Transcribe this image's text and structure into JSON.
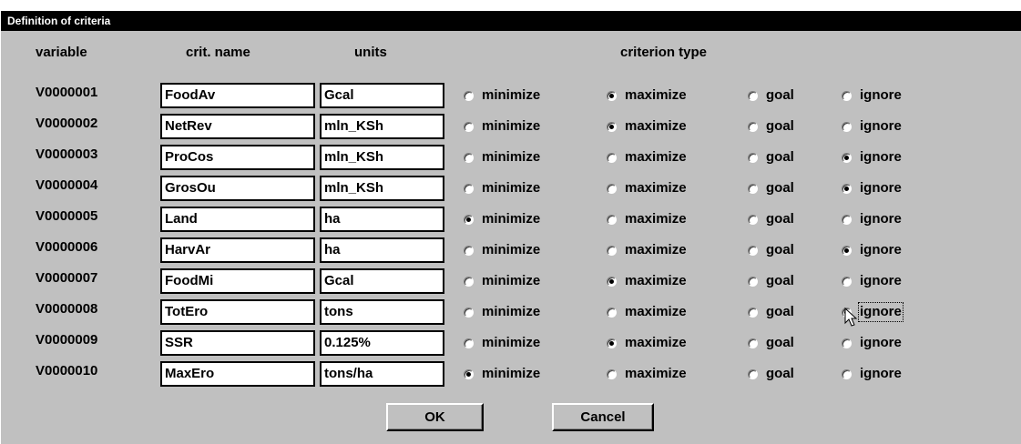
{
  "dialog": {
    "title": "Definition of criteria"
  },
  "headers": {
    "variable": "variable",
    "crit_name": "crit. name",
    "units": "units",
    "criterion_type": "criterion type"
  },
  "radio_labels": [
    "minimize",
    "maximize",
    "goal",
    "ignore"
  ],
  "rows": [
    {
      "var": "V0000001",
      "name": "FoodAv",
      "units": "Gcal",
      "selected": "maximize"
    },
    {
      "var": "V0000002",
      "name": "NetRev",
      "units": "mln_KSh",
      "selected": "maximize"
    },
    {
      "var": "V0000003",
      "name": "ProCos",
      "units": "mln_KSh",
      "selected": "ignore"
    },
    {
      "var": "V0000004",
      "name": "GrosOu",
      "units": "mln_KSh",
      "selected": "ignore"
    },
    {
      "var": "V0000005",
      "name": "Land",
      "units": "ha",
      "selected": "minimize"
    },
    {
      "var": "V0000006",
      "name": "HarvAr",
      "units": "ha",
      "selected": "ignore"
    },
    {
      "var": "V0000007",
      "name": "FoodMi",
      "units": "Gcal",
      "selected": "maximize"
    },
    {
      "var": "V0000008",
      "name": "TotEro",
      "units": "tons",
      "selected": "ignore"
    },
    {
      "var": "V0000009",
      "name": "SSR",
      "units": "0.125%",
      "selected": "maximize"
    },
    {
      "var": "V0000010",
      "name": "MaxEro",
      "units": "tons/ha",
      "selected": "minimize"
    }
  ],
  "focused": {
    "row": 7,
    "option": "ignore"
  },
  "buttons": {
    "ok": "OK",
    "cancel": "Cancel"
  },
  "cursor": {
    "icon": "arrow-pointer-icon"
  },
  "colors": {
    "titlebar": "#000000",
    "dialog_bg": "#c0c0c0",
    "field_bg": "#ffffff"
  }
}
